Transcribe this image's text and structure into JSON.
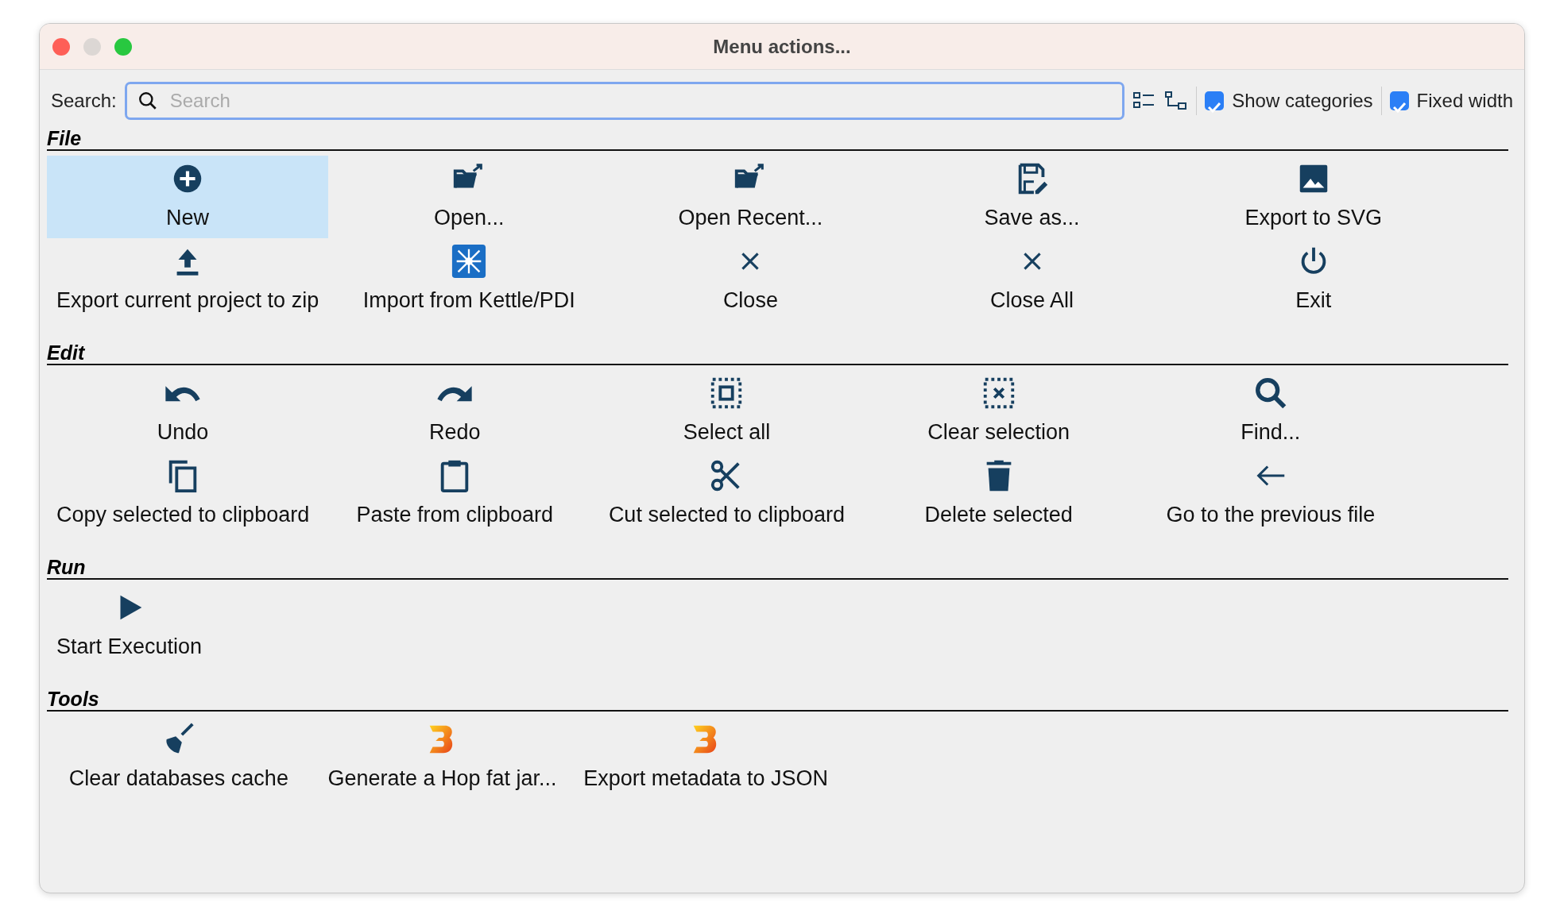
{
  "window": {
    "title": "Menu actions..."
  },
  "search": {
    "label": "Search:",
    "placeholder": "Search"
  },
  "options": [
    {
      "label": "Show categories",
      "checked": true
    },
    {
      "label": "Fixed width",
      "checked": true
    }
  ],
  "categories": [
    {
      "name": "File",
      "items": [
        {
          "label": "New",
          "selected": true
        },
        {
          "label": "Open...",
          "selected": false
        },
        {
          "label": "Open Recent...",
          "selected": false
        },
        {
          "label": "Save as...",
          "selected": false
        },
        {
          "label": "Export to SVG",
          "selected": false
        },
        {
          "label": "Export current project to zip",
          "selected": false
        },
        {
          "label": "Import from Kettle/PDI",
          "selected": false
        },
        {
          "label": "Close",
          "selected": false
        },
        {
          "label": "Close All",
          "selected": false
        },
        {
          "label": "Exit",
          "selected": false
        }
      ]
    },
    {
      "name": "Edit",
      "items": [
        {
          "label": "Undo",
          "selected": false
        },
        {
          "label": "Redo",
          "selected": false
        },
        {
          "label": "Select all",
          "selected": false
        },
        {
          "label": "Clear selection",
          "selected": false
        },
        {
          "label": "Find...",
          "selected": false
        },
        {
          "label": "Copy selected to clipboard",
          "selected": false
        },
        {
          "label": "Paste from clipboard",
          "selected": false
        },
        {
          "label": "Cut selected to clipboard",
          "selected": false
        },
        {
          "label": "Delete selected",
          "selected": false
        },
        {
          "label": "Go to the previous file",
          "selected": false
        }
      ]
    },
    {
      "name": "Run",
      "items": [
        {
          "label": "Start Execution",
          "selected": false
        }
      ]
    },
    {
      "name": "Tools",
      "items": [
        {
          "label": "Clear databases cache",
          "selected": false
        },
        {
          "label": "Generate a Hop fat jar...",
          "selected": false
        },
        {
          "label": "Export metadata to JSON",
          "selected": false
        }
      ]
    }
  ]
}
